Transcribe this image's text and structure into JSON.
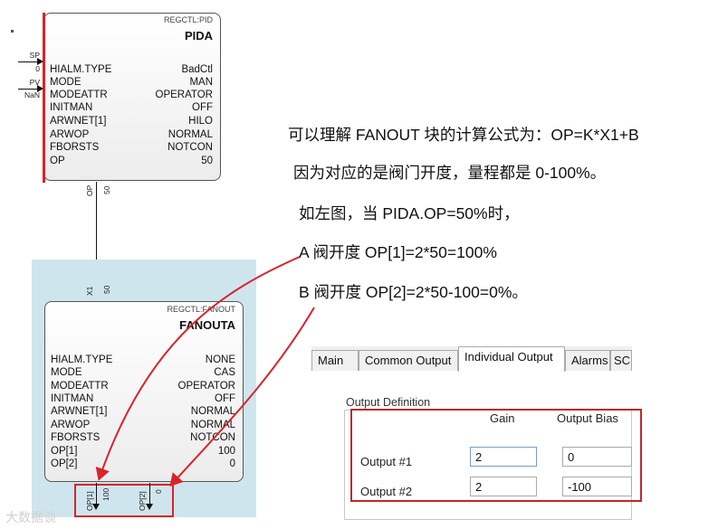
{
  "pida": {
    "type_label": "REGCTL:PID",
    "name": "PIDA",
    "inputs": [
      {
        "name": "SP",
        "value": "0"
      },
      {
        "name": "PV",
        "value": "NaN"
      }
    ],
    "params": [
      {
        "name": "HIALM.TYPE",
        "value": "BadCtl"
      },
      {
        "name": "MODE",
        "value": "MAN"
      },
      {
        "name": "MODEATTR",
        "value": "OPERATOR"
      },
      {
        "name": "INITMAN",
        "value": "OFF"
      },
      {
        "name": "ARWNET[1]",
        "value": "HILO"
      },
      {
        "name": "ARWOP",
        "value": "NORMAL"
      },
      {
        "name": "FBORSTS",
        "value": "NOTCON"
      },
      {
        "name": "OP",
        "value": "50"
      }
    ],
    "output_pin": {
      "name": "OP",
      "value": "50"
    }
  },
  "fanout": {
    "input_pin": {
      "name": "X1",
      "value": "50"
    },
    "type_label": "REGCTL:FANOUT",
    "name": "FANOUTA",
    "params": [
      {
        "name": "HIALM.TYPE",
        "value": "NONE"
      },
      {
        "name": "MODE",
        "value": "CAS"
      },
      {
        "name": "MODEATTR",
        "value": "OPERATOR"
      },
      {
        "name": "INITMAN",
        "value": "OFF"
      },
      {
        "name": "ARWNET[1]",
        "value": "NORMAL"
      },
      {
        "name": "ARWOP",
        "value": "NORMAL"
      },
      {
        "name": "FBORSTS",
        "value": "NOTCON"
      },
      {
        "name": "OP[1]",
        "value": "100"
      },
      {
        "name": "OP[2]",
        "value": "0"
      }
    ],
    "outputs": [
      {
        "name": "OP[1]",
        "value": "100"
      },
      {
        "name": "OP[2]",
        "value": "0"
      }
    ]
  },
  "explanation": [
    "可以理解 FANOUT 块的计算公式为：OP=K*X1+B",
    "因为对应的是阀门开度，量程都是 0-100%。",
    "如左图，当 PIDA.OP=50%时，",
    "A 阀开度 OP[1]=2*50=100%",
    "B 阀开度 OP[2]=2*50-100=0%。"
  ],
  "properties": {
    "tabs": [
      "Main",
      "Common Output",
      "Individual Output",
      "Alarms",
      "SC"
    ],
    "active_tab": "Individual Output",
    "group_title": "Output Definition",
    "columns": [
      "Gain",
      "Output Bias"
    ],
    "rows": [
      {
        "label": "Output #1",
        "gain": "2",
        "bias": "0"
      },
      {
        "label": "Output #2",
        "gain": "2",
        "bias": "-100"
      }
    ]
  },
  "watermark": "大数据谈",
  "colors": {
    "highlight_red": "#d8232a",
    "fanout_background": "#cfe5ee",
    "input_border": "#7a9cc8"
  }
}
